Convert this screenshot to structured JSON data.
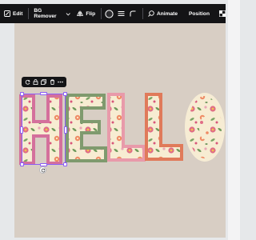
{
  "toolbar": {
    "edit_label": "Edit",
    "bg_remover_label": "BG Remover",
    "flip_label": "Flip",
    "animate_label": "Animate",
    "position_label": "Position"
  },
  "canvas": {
    "background_color": "#d8cec4",
    "letters": [
      "H",
      "E",
      "L",
      "L",
      "O"
    ],
    "letter_border_colors": [
      "#d4709c",
      "#7f9a6e",
      "#e89aaa",
      "#e07a5a",
      "#f6ecd4"
    ]
  },
  "colors": {
    "selection": "#8b5cf6",
    "toolbar_bg": "#141416"
  }
}
